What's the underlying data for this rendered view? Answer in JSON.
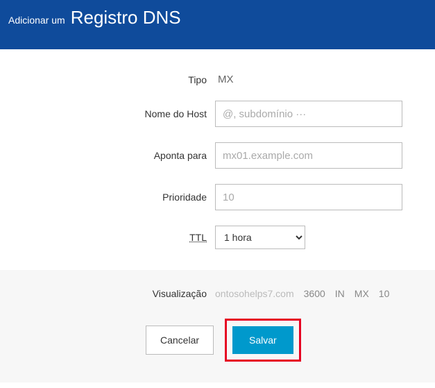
{
  "header": {
    "pre": "Adicionar um",
    "title": "Registro DNS"
  },
  "fields": {
    "type": {
      "label": "Tipo",
      "value": "MX"
    },
    "host": {
      "label": "Nome do Host",
      "placeholder": "@, subdomínio ···"
    },
    "points_to": {
      "label": "Aponta para",
      "placeholder": "mx01.example.com"
    },
    "priority": {
      "label": "Prioridade",
      "placeholder": "10"
    },
    "ttl": {
      "label": "TTL",
      "selected": "1 hora"
    }
  },
  "preview": {
    "label": "Visualização",
    "domain": "ontosohelps7.com",
    "ttl": "3600",
    "class": "IN",
    "type": "MX",
    "priority": "10"
  },
  "buttons": {
    "cancel": "Cancelar",
    "save": "Salvar"
  }
}
